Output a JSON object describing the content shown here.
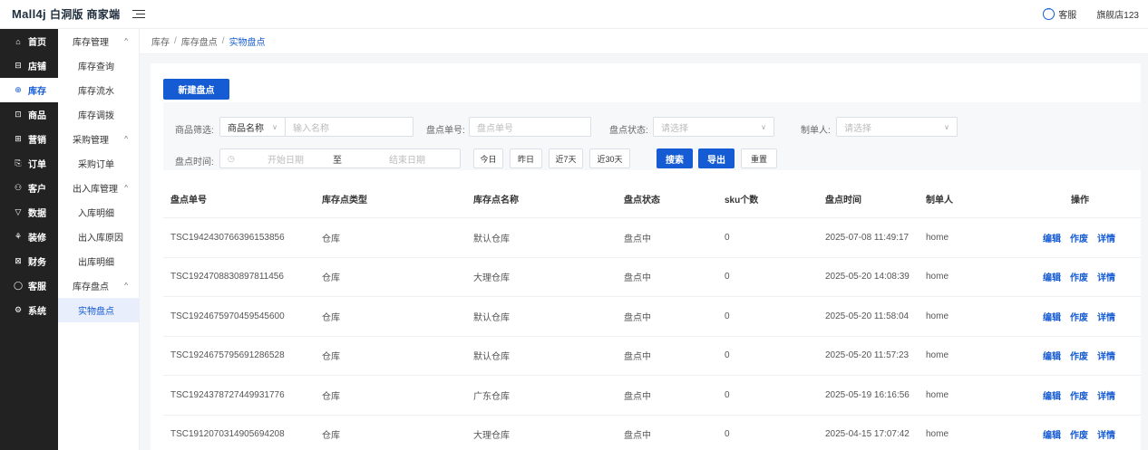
{
  "app": {
    "brand": "Mall4j",
    "subtitle": "白洞版 商家端"
  },
  "topbar": {
    "customer_service": "客服",
    "shop_name": "旗舰店123"
  },
  "nav": [
    {
      "label": "首页",
      "icon": "home-icon",
      "glyph": "⌂"
    },
    {
      "label": "店铺",
      "icon": "shop-icon",
      "glyph": "⊟"
    },
    {
      "label": "库存",
      "icon": "inventory-icon",
      "glyph": "⊕",
      "active": true
    },
    {
      "label": "商品",
      "icon": "product-icon",
      "glyph": "⊡"
    },
    {
      "label": "营销",
      "icon": "marketing-icon",
      "glyph": "⊞"
    },
    {
      "label": "订单",
      "icon": "order-icon",
      "glyph": "⎘"
    },
    {
      "label": "客户",
      "icon": "customer-icon",
      "glyph": "⚇"
    },
    {
      "label": "数据",
      "icon": "data-icon",
      "glyph": "▽"
    },
    {
      "label": "装修",
      "icon": "decor-icon",
      "glyph": "⚘"
    },
    {
      "label": "财务",
      "icon": "finance-icon",
      "glyph": "⊠"
    },
    {
      "label": "客服",
      "icon": "service-icon",
      "glyph": "◯"
    },
    {
      "label": "系统",
      "icon": "system-icon",
      "glyph": "⚙"
    }
  ],
  "subnav": [
    {
      "type": "group",
      "label": "库存管理",
      "arrow": "^"
    },
    {
      "type": "sub",
      "label": "库存查询"
    },
    {
      "type": "sub",
      "label": "库存流水"
    },
    {
      "type": "sub",
      "label": "库存调拨"
    },
    {
      "type": "group",
      "label": "采购管理",
      "arrow": "^"
    },
    {
      "type": "sub",
      "label": "采购订单"
    },
    {
      "type": "group",
      "label": "出入库管理",
      "arrow": "^"
    },
    {
      "type": "sub",
      "label": "入库明细"
    },
    {
      "type": "sub",
      "label": "出入库原因"
    },
    {
      "type": "sub",
      "label": "出库明细"
    },
    {
      "type": "group",
      "label": "库存盘点",
      "arrow": "^"
    },
    {
      "type": "sub",
      "label": "实物盘点",
      "active": true
    }
  ],
  "breadcrumb": {
    "l1": "库存",
    "l2": "库存盘点",
    "l3": "实物盘点",
    "sep": "/"
  },
  "actions": {
    "new": "新建盘点"
  },
  "filter": {
    "product_label": "商品筛选:",
    "product_type": "商品名称",
    "product_placeholder": "输入名称",
    "code_label": "盘点单号:",
    "code_placeholder": "盘点单号",
    "status_label": "盘点状态:",
    "status_placeholder": "请选择",
    "maker_label": "制单人:",
    "maker_placeholder": "请选择",
    "time_label": "盘点时间:",
    "start_placeholder": "开始日期",
    "to": "至",
    "end_placeholder": "结束日期",
    "today": "今日",
    "yesterday": "昨日",
    "last7": "近7天",
    "last30": "近30天",
    "search": "搜索",
    "export": "导出",
    "reset": "重置"
  },
  "table": {
    "columns": [
      "盘点单号",
      "库存点类型",
      "库存点名称",
      "盘点状态",
      "sku个数",
      "盘点时间",
      "制单人",
      "操作"
    ],
    "op_edit": "编辑",
    "op_void": "作废",
    "op_detail": "详情",
    "rows": [
      [
        "TSC1942430766396153856",
        "仓库",
        "默认仓库",
        "盘点中",
        "0",
        "2025-07-08 11:49:17",
        "home"
      ],
      [
        "TSC1924708830897811456",
        "仓库",
        "大理仓库",
        "盘点中",
        "0",
        "2025-05-20 14:08:39",
        "home"
      ],
      [
        "TSC1924675970459545600",
        "仓库",
        "默认仓库",
        "盘点中",
        "0",
        "2025-05-20 11:58:04",
        "home"
      ],
      [
        "TSC1924675795691286528",
        "仓库",
        "默认仓库",
        "盘点中",
        "0",
        "2025-05-20 11:57:23",
        "home"
      ],
      [
        "TSC1924378727449931776",
        "仓库",
        "广东仓库",
        "盘点中",
        "0",
        "2025-05-19 16:16:56",
        "home"
      ],
      [
        "TSC1912070314905694208",
        "仓库",
        "大理仓库",
        "盘点中",
        "0",
        "2025-04-15 17:07:42",
        "home"
      ]
    ]
  }
}
